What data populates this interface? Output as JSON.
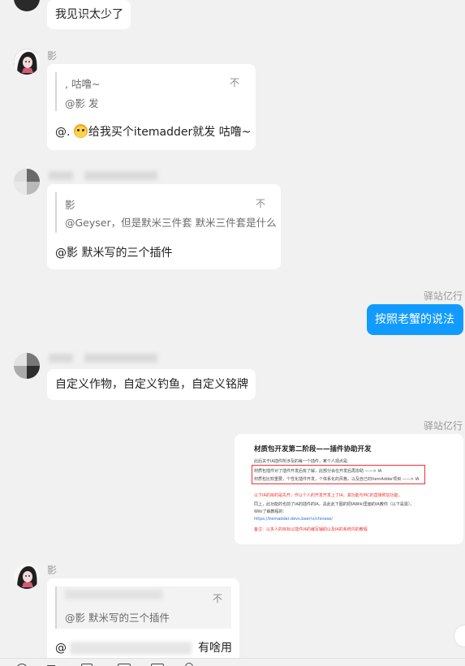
{
  "messages": {
    "m1": {
      "text": "我见识太少了"
    },
    "m2": {
      "sender": "影",
      "quote_line1": ", 咕噜~",
      "quote_line2": "@影 发",
      "quote_mark": "不",
      "text_prefix": "@. ",
      "text_suffix": "给我买个itemadder就发 咕噜~"
    },
    "m3": {
      "quote_line1": "影",
      "quote_line2": "@Geyser，但是默米三件套 默米三件套是什么",
      "quote_mark": "不",
      "text": "@影 默米写的三个插件"
    },
    "m4": {
      "sender": "驿站亿行",
      "text": "按照老蟹的说法"
    },
    "m5": {
      "text": "自定义作物，自定义钓鱼，自定义铭牌"
    },
    "m6": {
      "sender": "驿站亿行",
      "doc_title": "材质包开发第二阶段——插件协助开发",
      "doc_lines": [
        "此后关于IA插件所涉及的每一个插件，某个人观点是:",
        "材质包插件对了插件开发后有了解，此部分会在开发后再协助 ——> IA",
        "材质包比较重要，个性化插件开发，个体系化的风格，以及自己的ItemAdder项目 ——> IA",
        "以下IA的目的是先开，作以个人的开发开发上了IA，其功能与MC的直接附加功能。",
        "同上，此功能的也前了IA的插件的IA，具此此下图的把IAWiki里面的IA教你（以下是需），",
        "Wiki了解教程的:",
        "https://itemadder.devs.beer/v/chinese/",
        "备注：以多人的目标以插件IA的编写辅助以及IA的系统内的教程"
      ]
    },
    "m7": {
      "sender": "影",
      "quote_line1": "@影 默米写的三个插件",
      "quote_mark": "不",
      "text_prefix": "@",
      "text_suffix": "有啥用"
    }
  },
  "colors": {
    "background": "#f1f1f1",
    "bubble": "#ffffff",
    "self_bubble": "#129bff",
    "sender_name": "#999999"
  },
  "icons": [
    "avatar-anime-girl",
    "avatar-pixelated",
    "emoji-face",
    "toolbar-icons"
  ]
}
